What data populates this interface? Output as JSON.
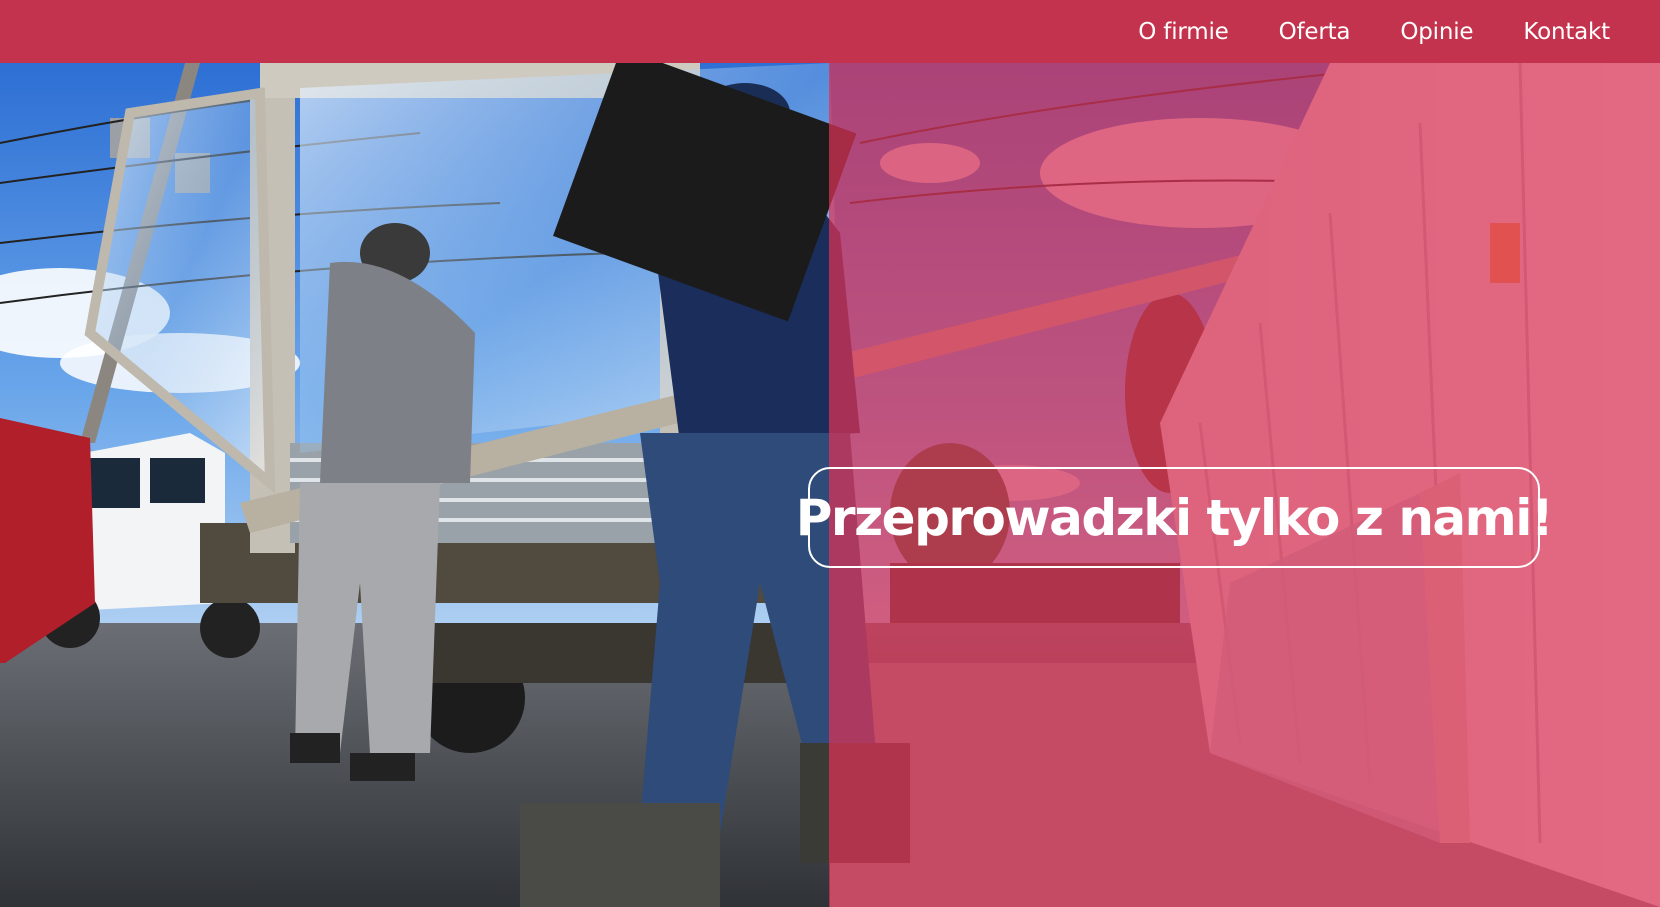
{
  "nav": {
    "items": [
      {
        "label": "O firmie"
      },
      {
        "label": "Oferta"
      },
      {
        "label": "Opinie"
      },
      {
        "label": "Kontakt"
      }
    ]
  },
  "hero": {
    "headline": "Przeprowadzki tylko z nami!"
  },
  "colors": {
    "brand": "#c3334d",
    "overlay": "#dc3255",
    "text": "#ffffff"
  }
}
